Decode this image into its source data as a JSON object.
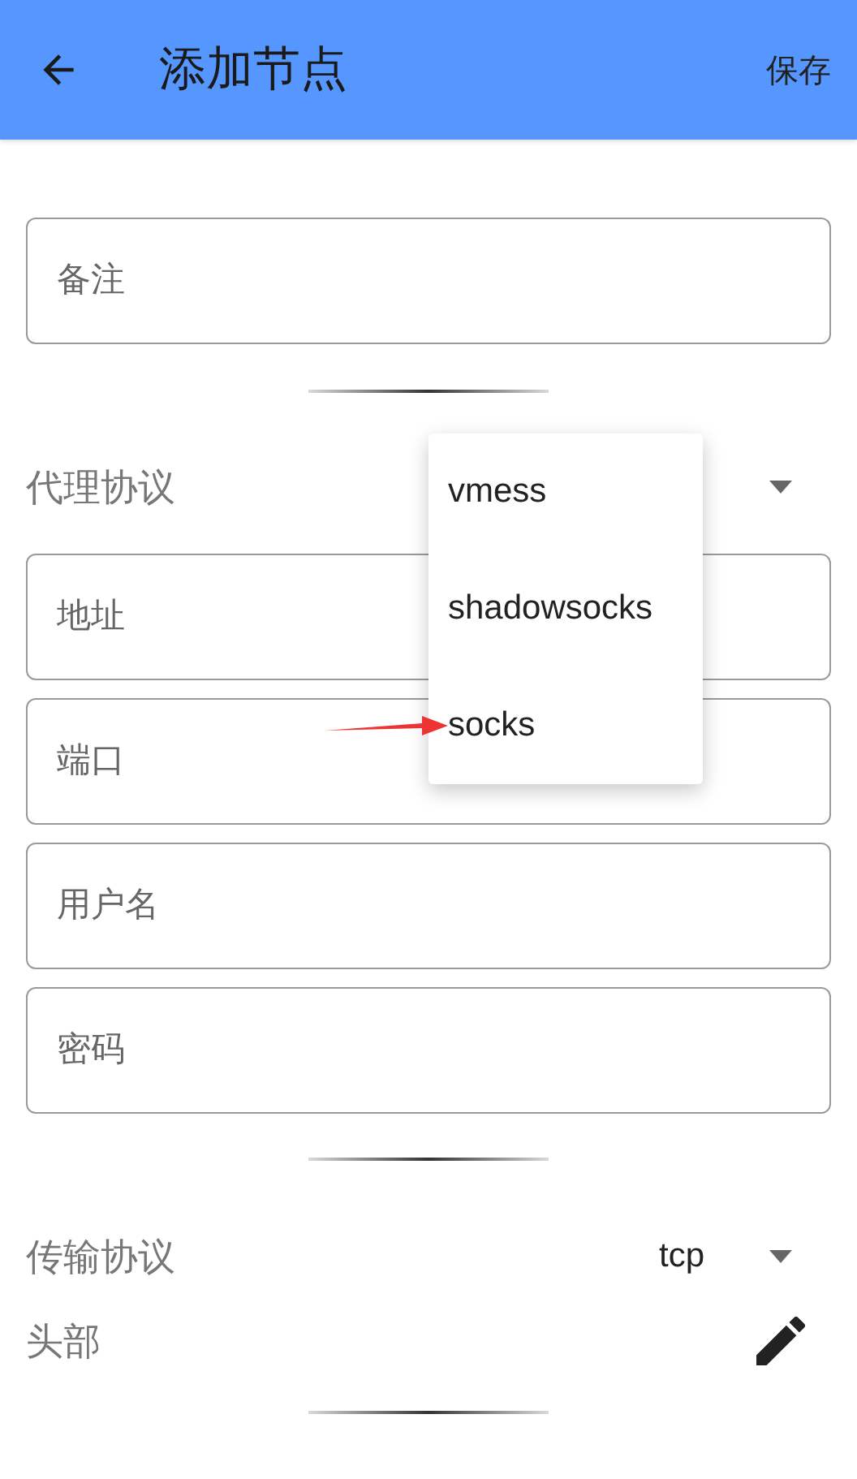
{
  "app_bar": {
    "title": "添加节点",
    "action": "保存"
  },
  "remark_field": {
    "placeholder": "备注"
  },
  "proxy_protocol": {
    "label": "代理协议"
  },
  "protocol_menu": {
    "options": [
      {
        "label": "vmess"
      },
      {
        "label": "shadowsocks"
      },
      {
        "label": "socks"
      }
    ]
  },
  "server_fields": [
    {
      "placeholder": "地址"
    },
    {
      "placeholder": "端口"
    },
    {
      "placeholder": "用户名"
    },
    {
      "placeholder": "密码"
    }
  ],
  "transport": {
    "label": "传输协议",
    "value": "tcp"
  },
  "header": {
    "label": "头部"
  }
}
